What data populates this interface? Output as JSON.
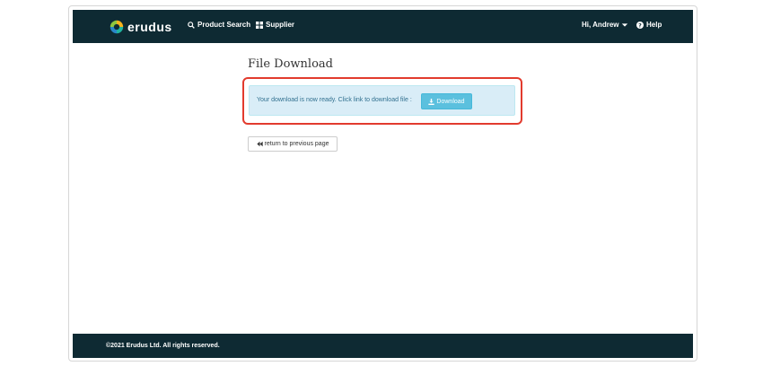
{
  "brand": {
    "logo_text": "erudus"
  },
  "nav": {
    "product_search": "Product Search",
    "supplier": "Supplier",
    "user": "Hi, Andrew",
    "help": "Help"
  },
  "page": {
    "title": "File Download",
    "alert_text": "Your download is now ready. Click link to download file :",
    "download_label": "Download",
    "back_label": "return to previous page"
  },
  "footer": {
    "copyright": "©2021 Erudus Ltd. All rights reserved."
  },
  "colors": {
    "navbar": "#0e2a33",
    "alert_bg": "#d9edf7",
    "alert_text": "#31708f",
    "button_info": "#5bc0de",
    "highlight": "#e23b2e"
  }
}
